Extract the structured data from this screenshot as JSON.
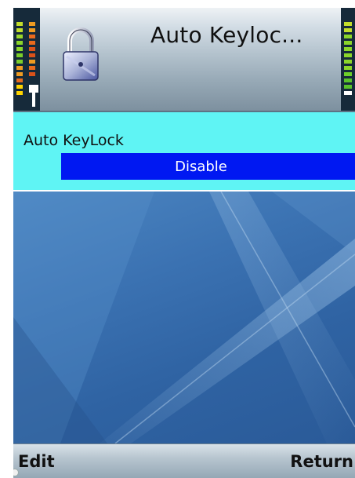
{
  "header": {
    "title": "Auto Keyloc...",
    "icon": "padlock-icon",
    "signal_icon": "signal-strength-icon",
    "battery_icon": "battery-level-icon"
  },
  "setting": {
    "label": "Auto KeyLock",
    "value": "Disable"
  },
  "softkeys": {
    "left_label": "Edit",
    "right_label": "Return"
  },
  "colors": {
    "panel_bg": "#5ff4f4",
    "selection_bg": "#0018f2",
    "selection_text": "#ffffff",
    "wallpaper": "#2f66a6"
  }
}
